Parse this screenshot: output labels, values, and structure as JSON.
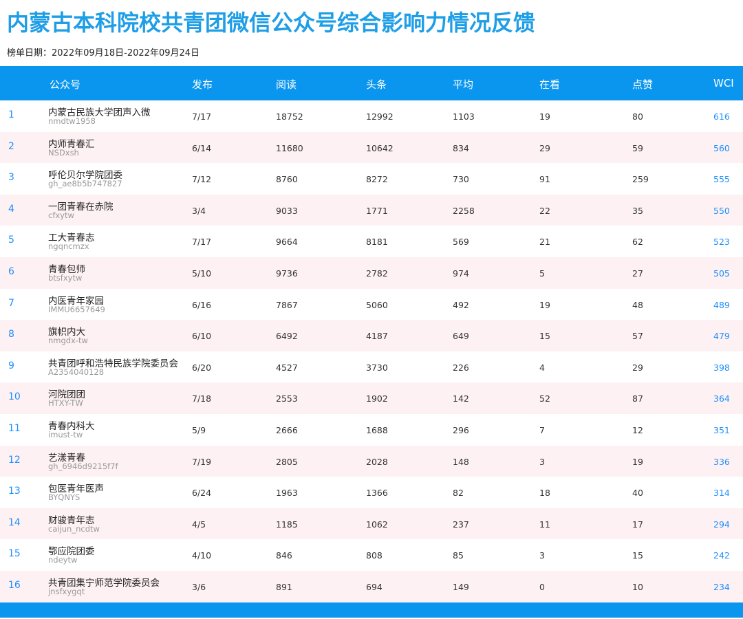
{
  "title": "内蒙古本科院校共青团微信公众号综合影响力情况反馈",
  "date_label": "榜单日期：2022年09月18日-2022年09月24日",
  "headers": {
    "account": "公众号",
    "publish": "发布",
    "read": "阅读",
    "headline": "头条",
    "avg": "平均",
    "watching": "在看",
    "like": "点赞",
    "wci": "WCI"
  },
  "rows": [
    {
      "rank": "1",
      "name": "内蒙古民族大学团声入微",
      "id": "nmdtw1958",
      "publish": "7/17",
      "read": "18752",
      "headline": "12992",
      "avg": "1103",
      "watching": "19",
      "like": "80",
      "wci": "616"
    },
    {
      "rank": "2",
      "name": "内师青春汇",
      "id": "NSDxsh",
      "publish": "6/14",
      "read": "11680",
      "headline": "10642",
      "avg": "834",
      "watching": "29",
      "like": "59",
      "wci": "560"
    },
    {
      "rank": "3",
      "name": "呼伦贝尔学院团委",
      "id": "gh_ae8b5b747827",
      "publish": "7/12",
      "read": "8760",
      "headline": "8272",
      "avg": "730",
      "watching": "91",
      "like": "259",
      "wci": "555"
    },
    {
      "rank": "4",
      "name": "一团青春在赤院",
      "id": "cfxytw",
      "publish": "3/4",
      "read": "9033",
      "headline": "1771",
      "avg": "2258",
      "watching": "22",
      "like": "35",
      "wci": "550"
    },
    {
      "rank": "5",
      "name": "工大青春志",
      "id": "ngqncmzx",
      "publish": "7/17",
      "read": "9664",
      "headline": "8181",
      "avg": "569",
      "watching": "21",
      "like": "62",
      "wci": "523"
    },
    {
      "rank": "6",
      "name": "青春包师",
      "id": "btsfxytw",
      "publish": "5/10",
      "read": "9736",
      "headline": "2782",
      "avg": "974",
      "watching": "5",
      "like": "27",
      "wci": "505"
    },
    {
      "rank": "7",
      "name": "内医青年家园",
      "id": "IMMU6657649",
      "publish": "6/16",
      "read": "7867",
      "headline": "5060",
      "avg": "492",
      "watching": "19",
      "like": "48",
      "wci": "489"
    },
    {
      "rank": "8",
      "name": "旗帜内大",
      "id": "nmgdx-tw",
      "publish": "6/10",
      "read": "6492",
      "headline": "4187",
      "avg": "649",
      "watching": "15",
      "like": "57",
      "wci": "479"
    },
    {
      "rank": "9",
      "name": "共青团呼和浩特民族学院委员会",
      "id": "A2354040128",
      "publish": "6/20",
      "read": "4527",
      "headline": "3730",
      "avg": "226",
      "watching": "4",
      "like": "29",
      "wci": "398"
    },
    {
      "rank": "10",
      "name": "河院团团",
      "id": "HTXY-TW",
      "publish": "7/18",
      "read": "2553",
      "headline": "1902",
      "avg": "142",
      "watching": "52",
      "like": "87",
      "wci": "364"
    },
    {
      "rank": "11",
      "name": "青春内科大",
      "id": "imust-tw",
      "publish": "5/9",
      "read": "2666",
      "headline": "1688",
      "avg": "296",
      "watching": "7",
      "like": "12",
      "wci": "351"
    },
    {
      "rank": "12",
      "name": "艺漾青春",
      "id": "gh_6946d9215f7f",
      "publish": "7/19",
      "read": "2805",
      "headline": "2028",
      "avg": "148",
      "watching": "3",
      "like": "19",
      "wci": "336"
    },
    {
      "rank": "13",
      "name": "包医青年医声",
      "id": "BYQNYS",
      "publish": "6/24",
      "read": "1963",
      "headline": "1366",
      "avg": "82",
      "watching": "18",
      "like": "40",
      "wci": "314"
    },
    {
      "rank": "14",
      "name": "财骏青年志",
      "id": "caijun_ncdtw",
      "publish": "4/5",
      "read": "1185",
      "headline": "1062",
      "avg": "237",
      "watching": "11",
      "like": "17",
      "wci": "294"
    },
    {
      "rank": "15",
      "name": "鄂应院团委",
      "id": "ndeytw",
      "publish": "4/10",
      "read": "846",
      "headline": "808",
      "avg": "85",
      "watching": "3",
      "like": "15",
      "wci": "242"
    },
    {
      "rank": "16",
      "name": "共青团集宁师范学院委员会",
      "id": "jnsfxygqt",
      "publish": "3/6",
      "read": "891",
      "headline": "694",
      "avg": "149",
      "watching": "0",
      "like": "10",
      "wci": "234"
    }
  ],
  "colors": {
    "accent": "#0a96ee",
    "title": "#1e9ee6",
    "row_alt": "#fdf1f3",
    "rank_wci": "#1e90ff"
  }
}
